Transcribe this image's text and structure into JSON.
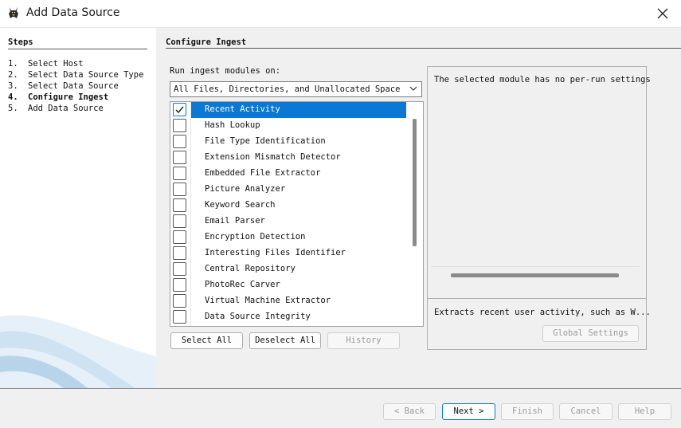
{
  "window": {
    "title": "Add Data Source",
    "icon": "autopsy-dog-icon"
  },
  "steps": {
    "heading": "Steps",
    "items": [
      {
        "num": "1.",
        "label": "Select Host"
      },
      {
        "num": "2.",
        "label": "Select Data Source Type"
      },
      {
        "num": "3.",
        "label": "Select Data Source"
      },
      {
        "num": "4.",
        "label": "Configure Ingest"
      },
      {
        "num": "5.",
        "label": "Add Data Source"
      }
    ],
    "active_index": 3
  },
  "configure": {
    "heading": "Configure Ingest",
    "run_label": "Run ingest modules on:",
    "run_value": "All Files, Directories, and Unallocated Space",
    "modules": [
      {
        "name": "Recent Activity",
        "checked": true,
        "selected": true
      },
      {
        "name": "Hash Lookup",
        "checked": false
      },
      {
        "name": "File Type Identification",
        "checked": false
      },
      {
        "name": "Extension Mismatch Detector",
        "checked": false
      },
      {
        "name": "Embedded File Extractor",
        "checked": false
      },
      {
        "name": "Picture Analyzer",
        "checked": false
      },
      {
        "name": "Keyword Search",
        "checked": false
      },
      {
        "name": "Email Parser",
        "checked": false
      },
      {
        "name": "Encryption Detection",
        "checked": false
      },
      {
        "name": "Interesting Files Identifier",
        "checked": false
      },
      {
        "name": "Central Repository",
        "checked": false
      },
      {
        "name": "PhotoRec Carver",
        "checked": false
      },
      {
        "name": "Virtual Machine Extractor",
        "checked": false
      },
      {
        "name": "Data Source Integrity",
        "checked": false
      }
    ],
    "select_all": "Select All",
    "deselect_all": "Deselect All",
    "history": "History",
    "settings_message": "The selected module has no per-run settings",
    "module_description": "Extracts recent user activity, such as W...",
    "global_settings": "Global Settings"
  },
  "footer": {
    "back": "< Back",
    "next": "Next >",
    "finish": "Finish",
    "cancel": "Cancel",
    "help": "Help"
  },
  "colors": {
    "selection": "#0a78d4",
    "panel_bg": "#f0f0f0",
    "steps_bg": "#ffffff"
  }
}
